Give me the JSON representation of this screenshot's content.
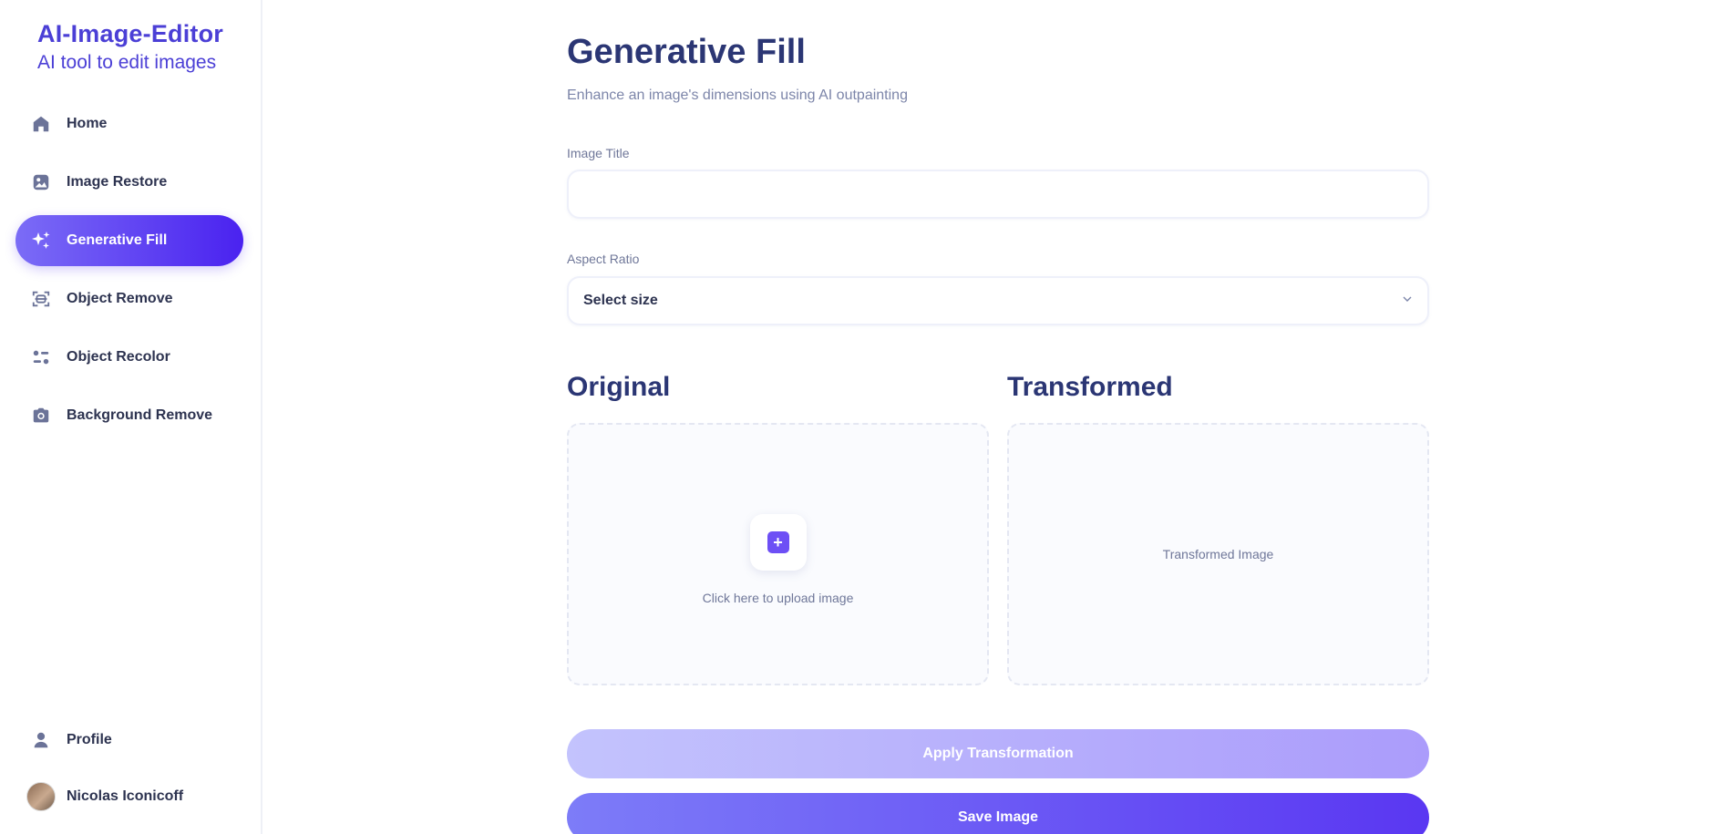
{
  "brand": {
    "title": "AI-Image-Editor",
    "subtitle": "AI tool to edit images"
  },
  "sidebar": {
    "items": [
      {
        "label": "Home",
        "icon": "home-icon"
      },
      {
        "label": "Image Restore",
        "icon": "image-icon"
      },
      {
        "label": "Generative Fill",
        "icon": "sparkles-icon",
        "active": true
      },
      {
        "label": "Object Remove",
        "icon": "scan-icon"
      },
      {
        "label": "Object Recolor",
        "icon": "filter-icon"
      },
      {
        "label": "Background Remove",
        "icon": "camera-icon"
      }
    ],
    "profile_label": "Profile",
    "user_name": "Nicolas Iconicoff"
  },
  "main": {
    "title": "Generative Fill",
    "subtitle": "Enhance an image's dimensions using AI outpainting",
    "image_title_label": "Image Title",
    "image_title_value": "",
    "aspect_ratio_label": "Aspect Ratio",
    "aspect_ratio_value": "Select size",
    "original_title": "Original",
    "upload_text": "Click here to upload image",
    "transformed_title": "Transformed",
    "transformed_placeholder": "Transformed Image",
    "apply_button": "Apply Transformation",
    "save_button": "Save Image"
  },
  "colors": {
    "brand": "#4b3fd6",
    "accent_start": "#7b6cf6",
    "accent_end": "#4a22f0",
    "heading": "#2b3674"
  }
}
